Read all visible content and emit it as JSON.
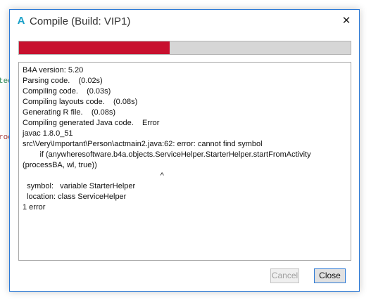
{
  "background": {
    "fragments": [
      {
        "text": "ted",
        "color": "#2e8b57"
      },
      {
        "text": "roc",
        "color": "#aa3333"
      }
    ]
  },
  "dialog": {
    "app_icon": "A",
    "title": "Compile (Build: VIP1)",
    "close_glyph": "✕",
    "progress": {
      "fraction": 0.455,
      "fill_color": "#c8102e",
      "track_color": "#d6d6d6"
    },
    "log_lines": [
      "B4A version: 5.20",
      "Parsing code.    (0.02s)",
      "Compiling code.    (0.03s)",
      "Compiling layouts code.    (0.08s)",
      "Generating R file.    (0.08s)",
      "Compiling generated Java code.    Error",
      "javac 1.8.0_51",
      "src\\Very\\Important\\Person\\actmain2.java:62: error: cannot find symbol",
      "        if (anywheresoftware.b4a.objects.ServiceHelper.StarterHelper.startFromActivity",
      "(processBA, wl, true))",
      "                                                                ^",
      "  symbol:   variable StarterHelper",
      "  location: class ServiceHelper",
      "1 error"
    ],
    "buttons": {
      "cancel": "Cancel",
      "close": "Close"
    }
  }
}
